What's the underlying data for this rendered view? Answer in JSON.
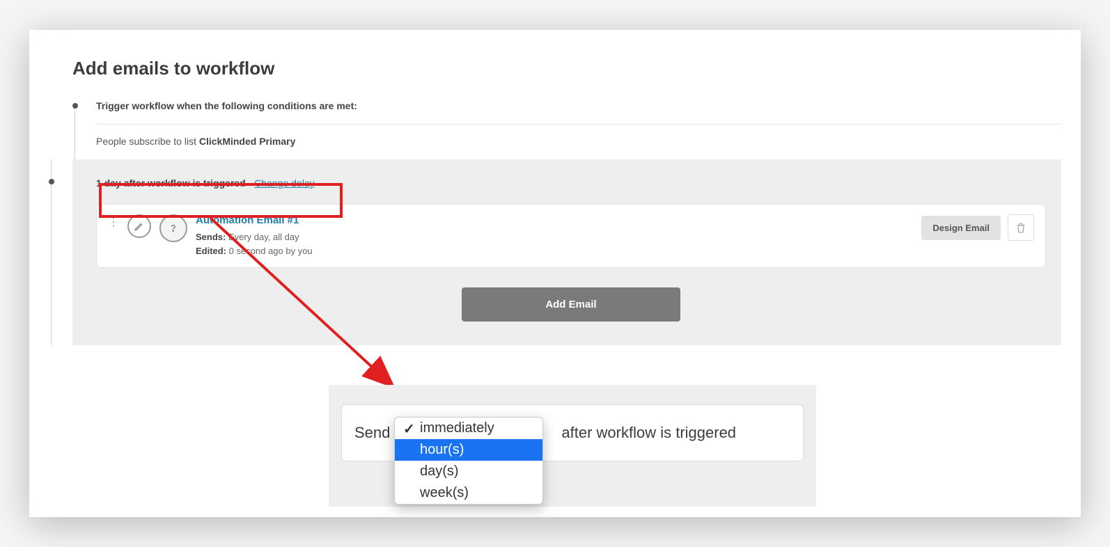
{
  "page": {
    "title": "Add emails to workflow"
  },
  "trigger": {
    "heading": "Trigger workflow when the following conditions are met:",
    "condition_prefix": "People subscribe to list ",
    "condition_list": "ClickMinded Primary"
  },
  "delay": {
    "text": "1 day after workflow is triggered",
    "separator": " · ",
    "change_link": "Change delay"
  },
  "email_card": {
    "title": "Automation Email #1",
    "sends_label": "Sends:",
    "sends_value": " Every day, all day",
    "edited_label": "Edited:",
    "edited_value": " 0 second ago by you",
    "design_button": "Design Email"
  },
  "add_email_button": "Add Email",
  "send_panel": {
    "prefix": "Send",
    "suffix": "after workflow is triggered"
  },
  "dropdown": {
    "options": [
      "immediately",
      "hour(s)",
      "day(s)",
      "week(s)"
    ],
    "checked_index": 0,
    "highlight_index": 1
  }
}
